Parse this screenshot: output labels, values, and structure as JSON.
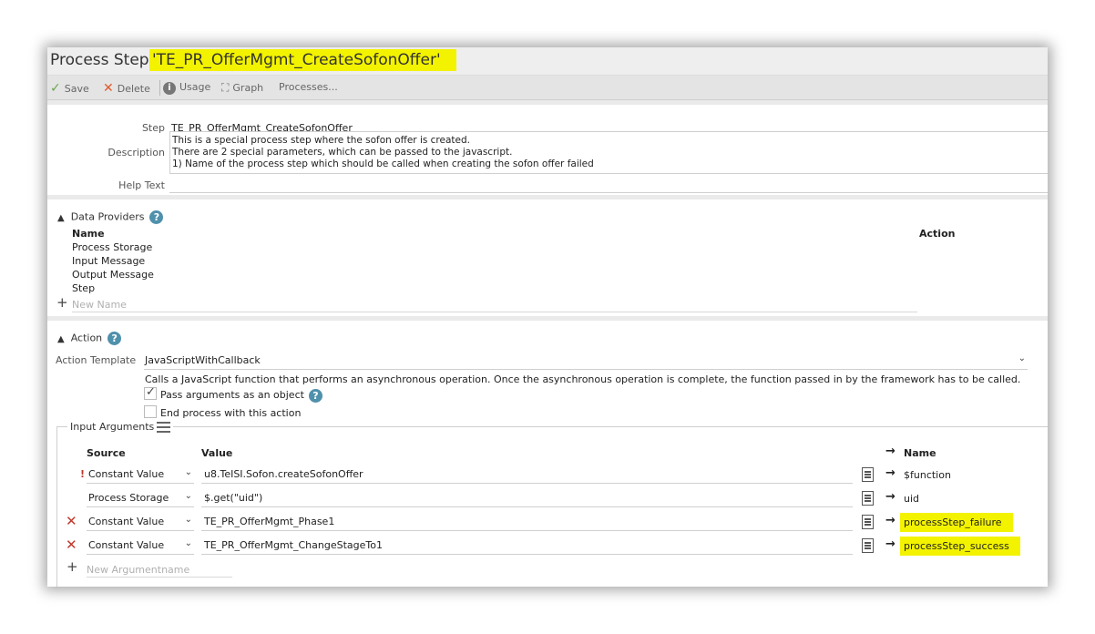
{
  "window": {
    "title_prefix": "Process Step",
    "title_name": "'TE_PR_OfferMgmt_CreateSofonOffer'"
  },
  "toolbar": {
    "save": "Save",
    "delete": "Delete",
    "usage": "Usage",
    "graph": "Graph",
    "processes": "Processes..."
  },
  "general": {
    "step_label": "Step",
    "step_value": "TE_PR_OfferMgmt_CreateSofonOffer",
    "description_label": "Description",
    "description_lines": [
      "This is a special process step where the sofon offer is created.",
      "There are 2 special parameters, which can be passed to the javascript.",
      "1) Name of the process step which should be called when creating the sofon offer failed"
    ],
    "help_text_label": "Help Text",
    "help_text_value": ""
  },
  "data_providers": {
    "title": "Data Providers",
    "col_name": "Name",
    "col_action": "Action",
    "items": [
      "Process Storage",
      "Input Message",
      "Output Message",
      "Step"
    ],
    "new_placeholder": "New Name"
  },
  "action": {
    "title": "Action",
    "template_label": "Action Template",
    "template_value": "JavaScriptWithCallback",
    "template_description": "Calls a JavaScript function that performs an asynchronous operation. Once the asynchronous operation is complete, the function passed in by the framework has to be called.",
    "pass_arguments_label": "Pass arguments as an object",
    "pass_arguments_checked": true,
    "end_process_label": "End process with this action",
    "end_process_checked": false
  },
  "input_arguments": {
    "title": "Input Arguments",
    "col_source": "Source",
    "col_value": "Value",
    "col_name": "Name",
    "rows": [
      {
        "marker": "!",
        "source": "Constant Value",
        "value": "u8.TeISI.Sofon.createSofonOffer",
        "name": "$function",
        "highlight": false
      },
      {
        "marker": "",
        "source": "Process Storage",
        "value": "$.get(\"uid\")",
        "name": "uid",
        "highlight": false
      },
      {
        "marker": "x",
        "source": "Constant Value",
        "value": "TE_PR_OfferMgmt_Phase1",
        "name": "processStep_failure",
        "highlight": true
      },
      {
        "marker": "x",
        "source": "Constant Value",
        "value": "TE_PR_OfferMgmt_ChangeStageTo1",
        "name": "processStep_success",
        "highlight": true
      }
    ],
    "new_placeholder": "New Argumentname"
  },
  "colors": {
    "highlight": "#f3f300",
    "delete_red": "#c0392b",
    "help_blue": "#4f90ac",
    "save_green": "#6aa84f"
  }
}
